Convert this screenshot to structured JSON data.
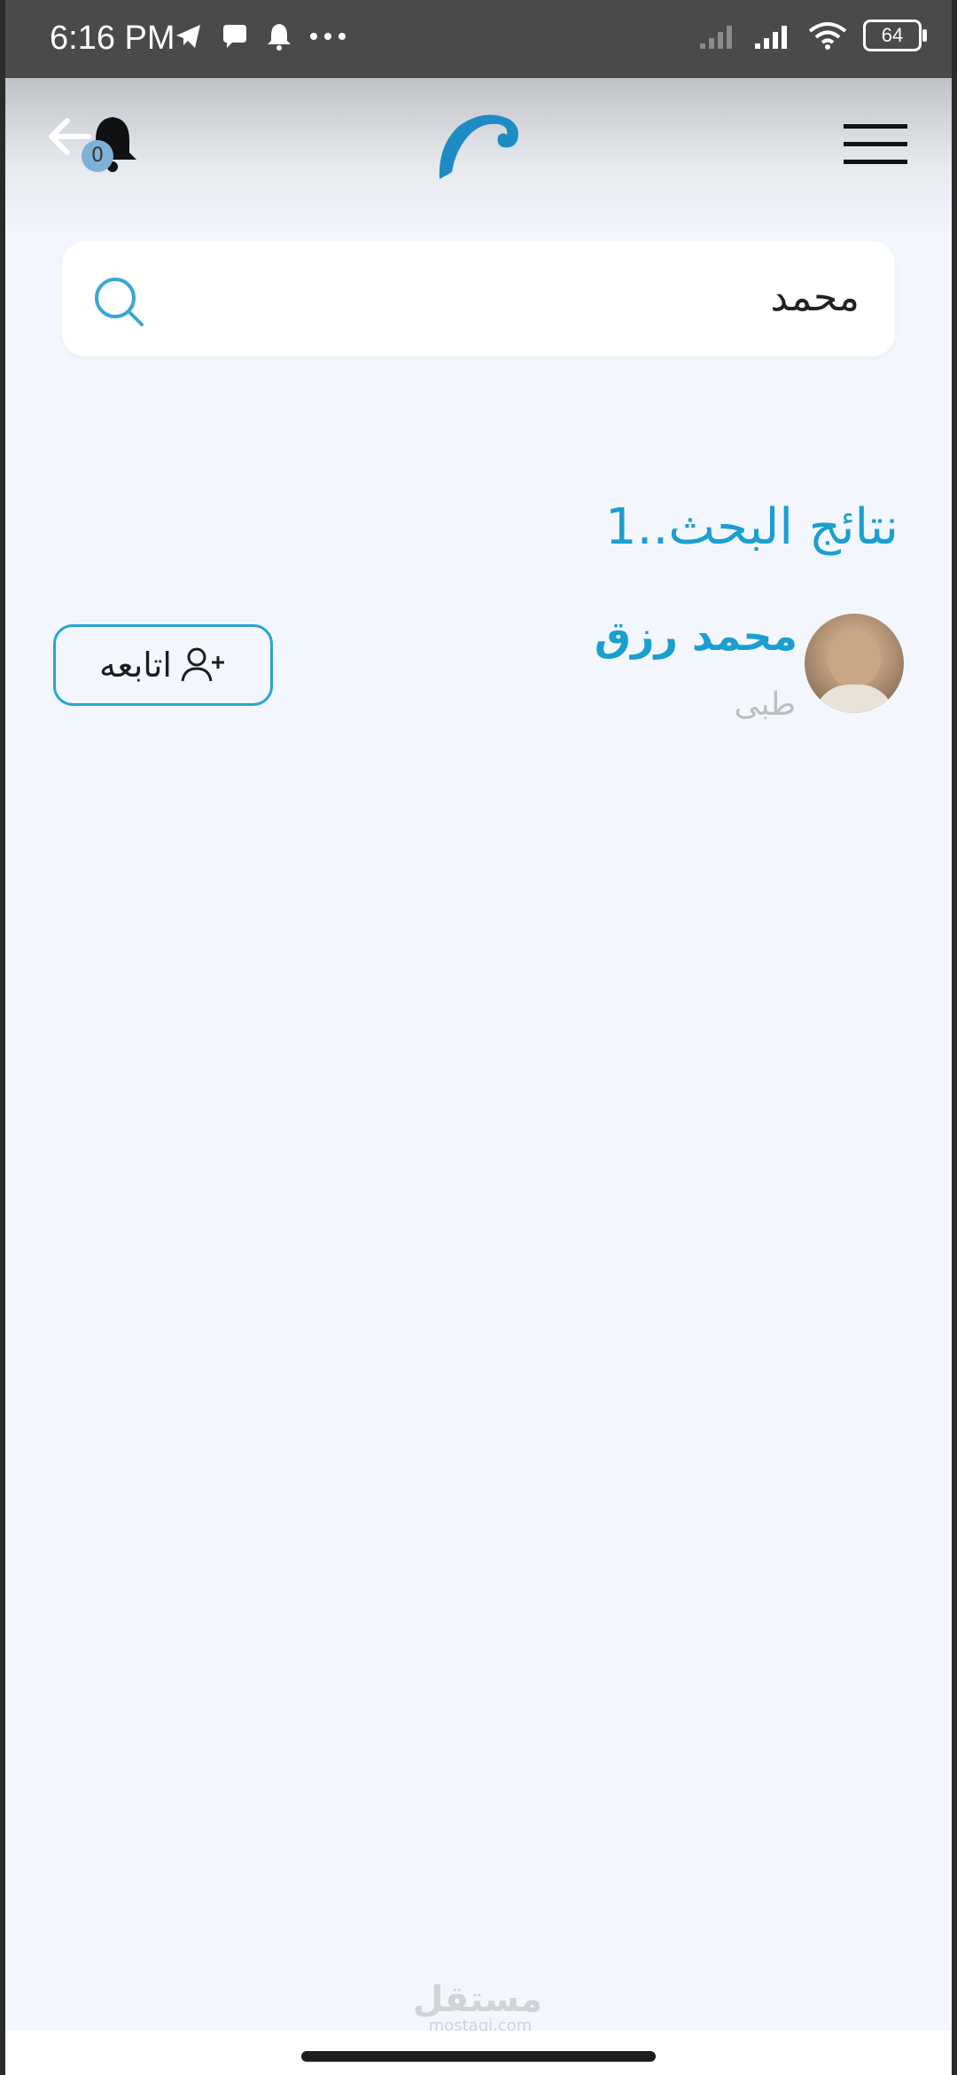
{
  "status_bar": {
    "time": "6:16 PM",
    "battery": "64",
    "icons_left": [
      "telegram-icon",
      "chat-bubble-icon",
      "notification-bell-icon",
      "more-dots-icon"
    ],
    "icons_right": [
      "signal-icon",
      "signal-icon",
      "wifi-icon",
      "battery-icon"
    ]
  },
  "header": {
    "notification_count": "0",
    "icons": [
      "back-arrow-icon",
      "bell-icon",
      "wave-logo-icon",
      "hamburger-menu-icon"
    ],
    "logo_color": "#1f8bc4"
  },
  "search": {
    "value": "محمد",
    "icon": "search-icon"
  },
  "results": {
    "title": "نتائج البحث..1",
    "items": [
      {
        "name": "محمد رزق",
        "subtitle": "طبى",
        "follow_label": "اتابعه",
        "follow_icon": "add-user-icon"
      }
    ]
  },
  "watermark": {
    "main": "مستقل",
    "sub": "mostaqi.com"
  },
  "colors": {
    "accent": "#1a9fcf",
    "background": "#f3f7fd",
    "subtitle": "#bdbdbd"
  }
}
